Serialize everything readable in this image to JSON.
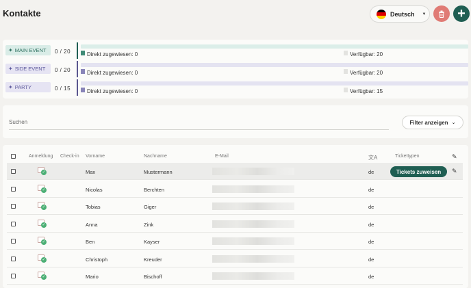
{
  "header": {
    "title": "Kontakte",
    "language": "Deutsch"
  },
  "colors": {
    "primary": "#1f5e52",
    "delete": "#e07b75",
    "check": "#4caf75"
  },
  "icons": {
    "delete": "trash-icon",
    "add": "plus-icon",
    "language": "germany-flag-icon",
    "dropdown": "chevron-down-icon",
    "edit": "pencil-icon",
    "translate": "translate-icon"
  },
  "events": [
    {
      "name": "MAIN EVENT",
      "count": "0 / 20",
      "assigned": "Direkt zugewiesen: 0",
      "available": "Verfügbar: 20"
    },
    {
      "name": "SIDE EVENT",
      "count": "0 / 20",
      "assigned": "Direkt zugewiesen: 0",
      "available": "Verfügbar: 20"
    },
    {
      "name": "PARTY",
      "count": "0 / 15",
      "assigned": "Direkt zugewiesen: 0",
      "available": "Verfügbar: 15"
    }
  ],
  "search": {
    "label": "Suchen",
    "filter_label": "Filter anzeigen"
  },
  "table": {
    "columns": {
      "anmeldung": "Anmeldung",
      "checkin": "Check-in",
      "vorname": "Vorname",
      "nachname": "Nachname",
      "email": "E-Mail",
      "tickettypen": "Tickettypen"
    },
    "assign_label": "Tickets zuweisen",
    "rows": [
      {
        "vorname": "Max",
        "nachname": "Mustermann",
        "lang": "de"
      },
      {
        "vorname": "Nicolas",
        "nachname": "Berchten",
        "lang": "de"
      },
      {
        "vorname": "Tobias",
        "nachname": "Giger",
        "lang": "de"
      },
      {
        "vorname": "Anna",
        "nachname": "Zink",
        "lang": "de"
      },
      {
        "vorname": "Ben",
        "nachname": "Kayser",
        "lang": "de"
      },
      {
        "vorname": "Christoph",
        "nachname": "Kreuder",
        "lang": "de"
      },
      {
        "vorname": "Mario",
        "nachname": "Bischoff",
        "lang": "de"
      }
    ]
  }
}
